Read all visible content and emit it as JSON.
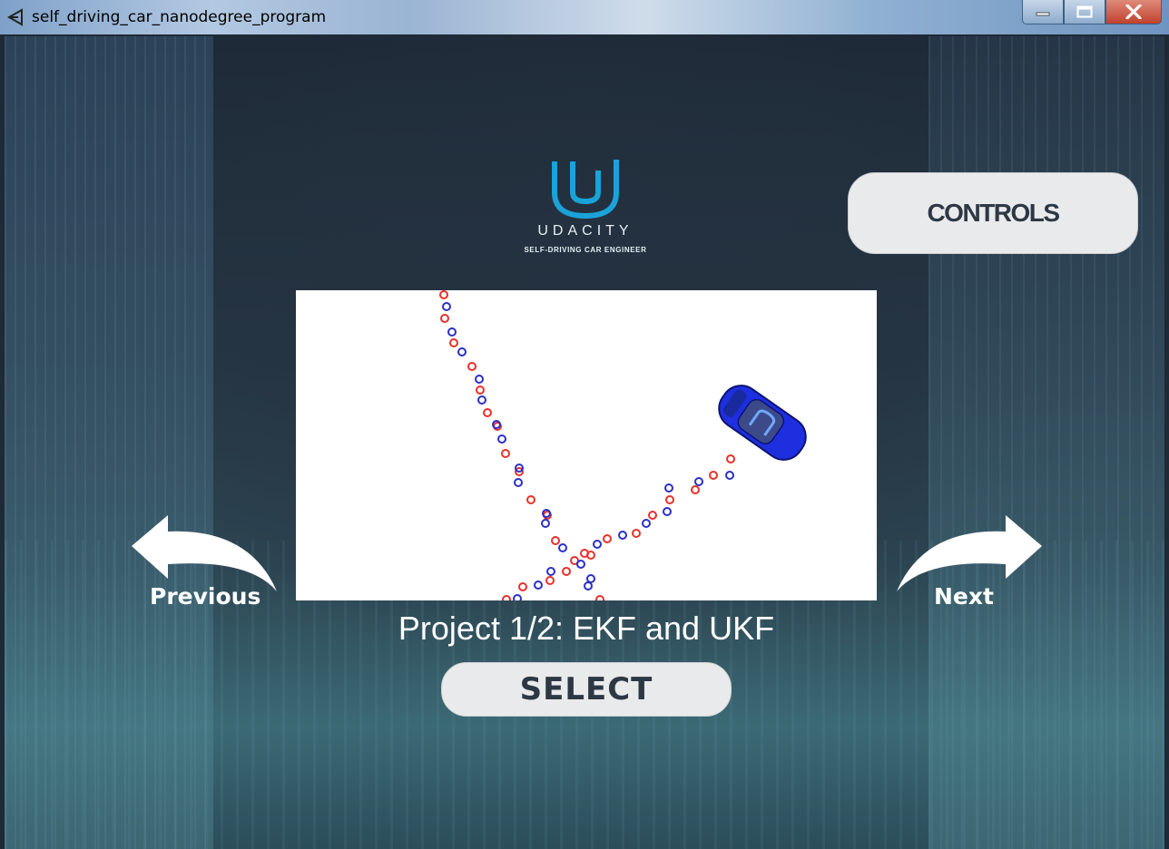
{
  "window": {
    "title": "self_driving_car_nanodegree_program",
    "app_icon": "unity-icon",
    "buttons": [
      "minimize-icon",
      "maximize-icon",
      "close-icon"
    ]
  },
  "logo": {
    "brand": "UDACITY",
    "tagline": "SELF-DRIVING CAR ENGINEER",
    "color": "#1aa3d9"
  },
  "controls_button": {
    "label": "CONTROLS"
  },
  "navigation": {
    "previous_label": "Previous",
    "next_label": "Next"
  },
  "project": {
    "title": "Project 1/2: EKF and UKF",
    "select_label": "SELECT"
  },
  "preview": {
    "red_marker_color": "#e8302a",
    "blue_marker_color": "#2b2fc7",
    "car_color": "#1e2fe0"
  }
}
